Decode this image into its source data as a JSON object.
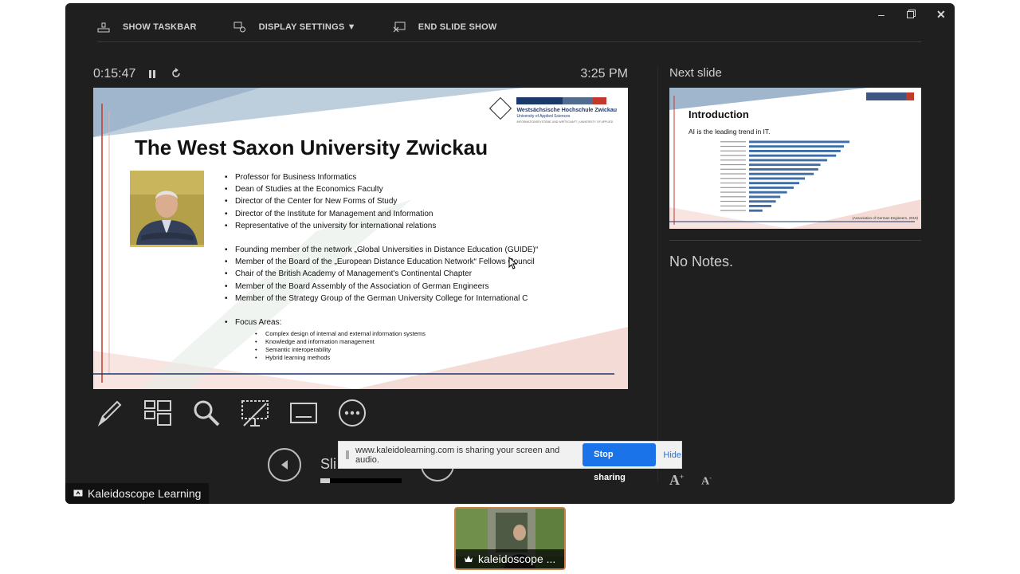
{
  "window": {
    "minimize_icon": "minimize-icon",
    "restore_icon": "restore-icon",
    "close_icon": "close-icon"
  },
  "toolbar": {
    "show_taskbar": "SHOW TASKBAR",
    "display_settings": "DISPLAY SETTINGS ▼",
    "end_slide_show": "END SLIDE SHOW"
  },
  "presenter": {
    "timer": "0:15:47",
    "clock": "3:25 PM"
  },
  "slide": {
    "title": "The West Saxon University Zwickau",
    "logo_line1": "Westsächsische Hochschule Zwickau",
    "logo_line2": "University of Applied Sciences",
    "logo_line3": "INFORMATIONSSYSTEME UND WIRTSCHAFT | UNIVERSITY OF APPLIED",
    "bullets_group1": [
      "Professor for Business Informatics",
      "Dean of Studies at the Economics Faculty",
      "Director of the Center for New Forms of Study",
      "Director of the Institute for Management and Information",
      "Representative of the university for international relations"
    ],
    "bullets_group2": [
      "Founding member of the network „Global Universities in Distance Education (GUIDE)“",
      "Member of the Board of the „European Distance Education Network“ Fellows Council",
      "Chair of the British Academy of Management's Continental Chapter",
      "Member of the Board Assembly of the Association of German Engineers",
      "Member of the Strategy Group of the German University College for International C"
    ],
    "focus_label": "Focus Areas:",
    "focus_items": [
      "Complex design of internal and external information systems",
      "Knowledge and information management",
      "Semantic interoperability",
      "Hybrid learning methods"
    ]
  },
  "controls": {
    "slide_label": "Sli",
    "progress": 0.12
  },
  "next_slide": {
    "label": "Next slide",
    "title": "Introduction",
    "subtitle": "AI is the leading trend in IT.",
    "source": "(Association of German Engineers, 2019)",
    "bar_values": [
      0.9,
      0.85,
      0.82,
      0.78,
      0.7,
      0.64,
      0.62,
      0.58,
      0.5,
      0.45,
      0.4,
      0.34,
      0.28,
      0.24,
      0.2,
      0.12
    ]
  },
  "notes": {
    "text": "No Notes."
  },
  "share_banner": {
    "message": "www.kaleidolearning.com is sharing your screen and audio.",
    "stop_label": "Stop sharing",
    "hide_label": "Hide"
  },
  "presenter_tag": {
    "name": "Kaleidoscope Learning"
  },
  "participant": {
    "name": "kaleidoscope ..."
  },
  "colors": {
    "accent": "#1a73e8",
    "slide_red": "#c0392b",
    "slide_blue": "#1b3a6b"
  }
}
